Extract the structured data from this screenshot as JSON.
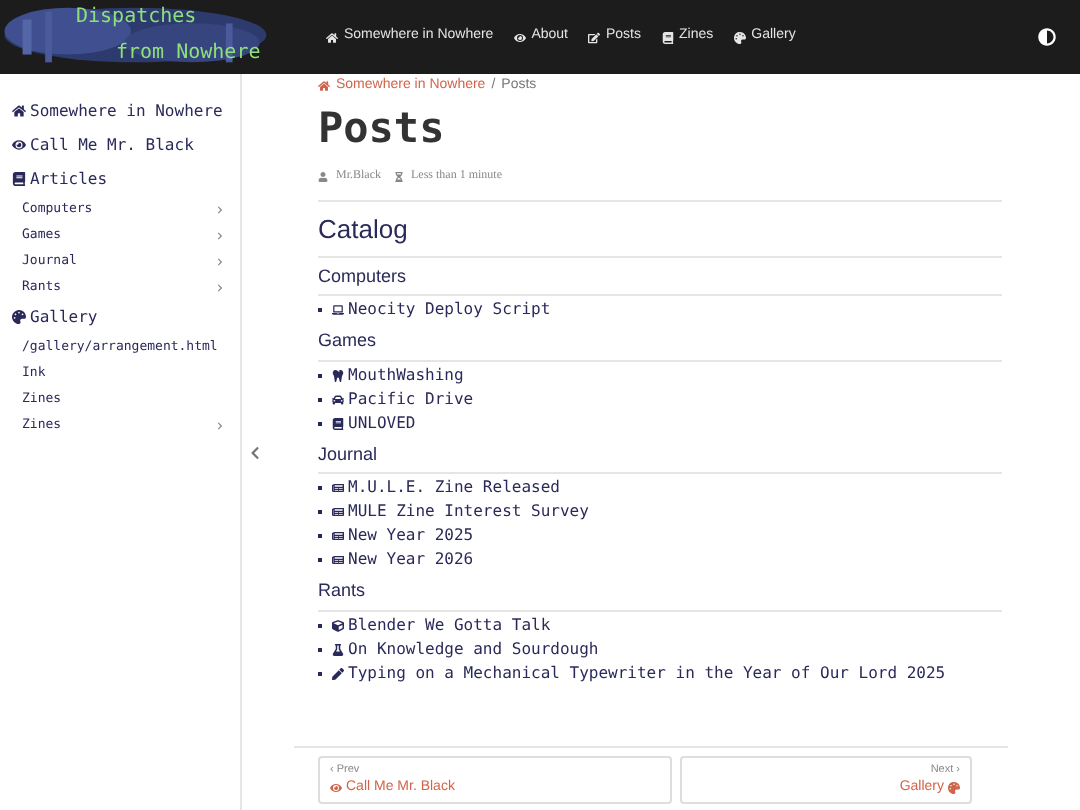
{
  "logo": {
    "line_1": "Dispatches",
    "line_2": "from Nowhere"
  },
  "nav": [
    "Somewhere in Nowhere",
    "About",
    "Posts",
    "Zines",
    "Gallery"
  ],
  "sidebar": {
    "sections": [
      {
        "label": "Somewhere in Nowhere"
      },
      {
        "label": "Call Me Mr. Black"
      },
      {
        "label": "Articles",
        "children": [
          {
            "label": "Computers",
            "kind": "folder"
          },
          {
            "label": "Games",
            "kind": "folder"
          },
          {
            "label": "Journal",
            "kind": "folder"
          },
          {
            "label": "Rants",
            "kind": "folder"
          }
        ]
      },
      {
        "label": "Gallery",
        "children": [
          {
            "label": "/gallery/arrangement.html",
            "kind": "page"
          },
          {
            "label": "Ink",
            "kind": "page"
          },
          {
            "label": "Zines",
            "kind": "page"
          },
          {
            "label": "Zines",
            "kind": "folder"
          }
        ]
      }
    ]
  },
  "breadcrumb": [
    "Somewhere in Nowhere",
    "/",
    "Posts"
  ],
  "title": "Posts",
  "meta": {
    "author": "Mr.Black",
    "reading_time": "Less than 1 minute"
  },
  "catalog": {
    "heading": "Catalog",
    "groups": [
      {
        "name": "Computers",
        "posts": [
          "Neocity Deploy Script"
        ]
      },
      {
        "name": "Games",
        "posts": [
          "MouthWashing",
          "Pacific Drive",
          "UNLOVED"
        ]
      },
      {
        "name": "Journal",
        "posts": [
          "M.U.L.E. Zine Released",
          "MULE Zine Interest Survey",
          "New Year 2025",
          "New Year 2026"
        ]
      },
      {
        "name": "Rants",
        "posts": [
          "Blender We Gotta Talk",
          "On Knowledge and Sourdough",
          "Typing on a Mechanical Typewriter in the Year of Our Lord 2025"
        ]
      }
    ]
  },
  "pager": {
    "prev": {
      "hint": "‹ Prev",
      "title": "Call Me Mr. Black"
    },
    "next": {
      "hint": "Next ›",
      "title": "Gallery"
    }
  }
}
